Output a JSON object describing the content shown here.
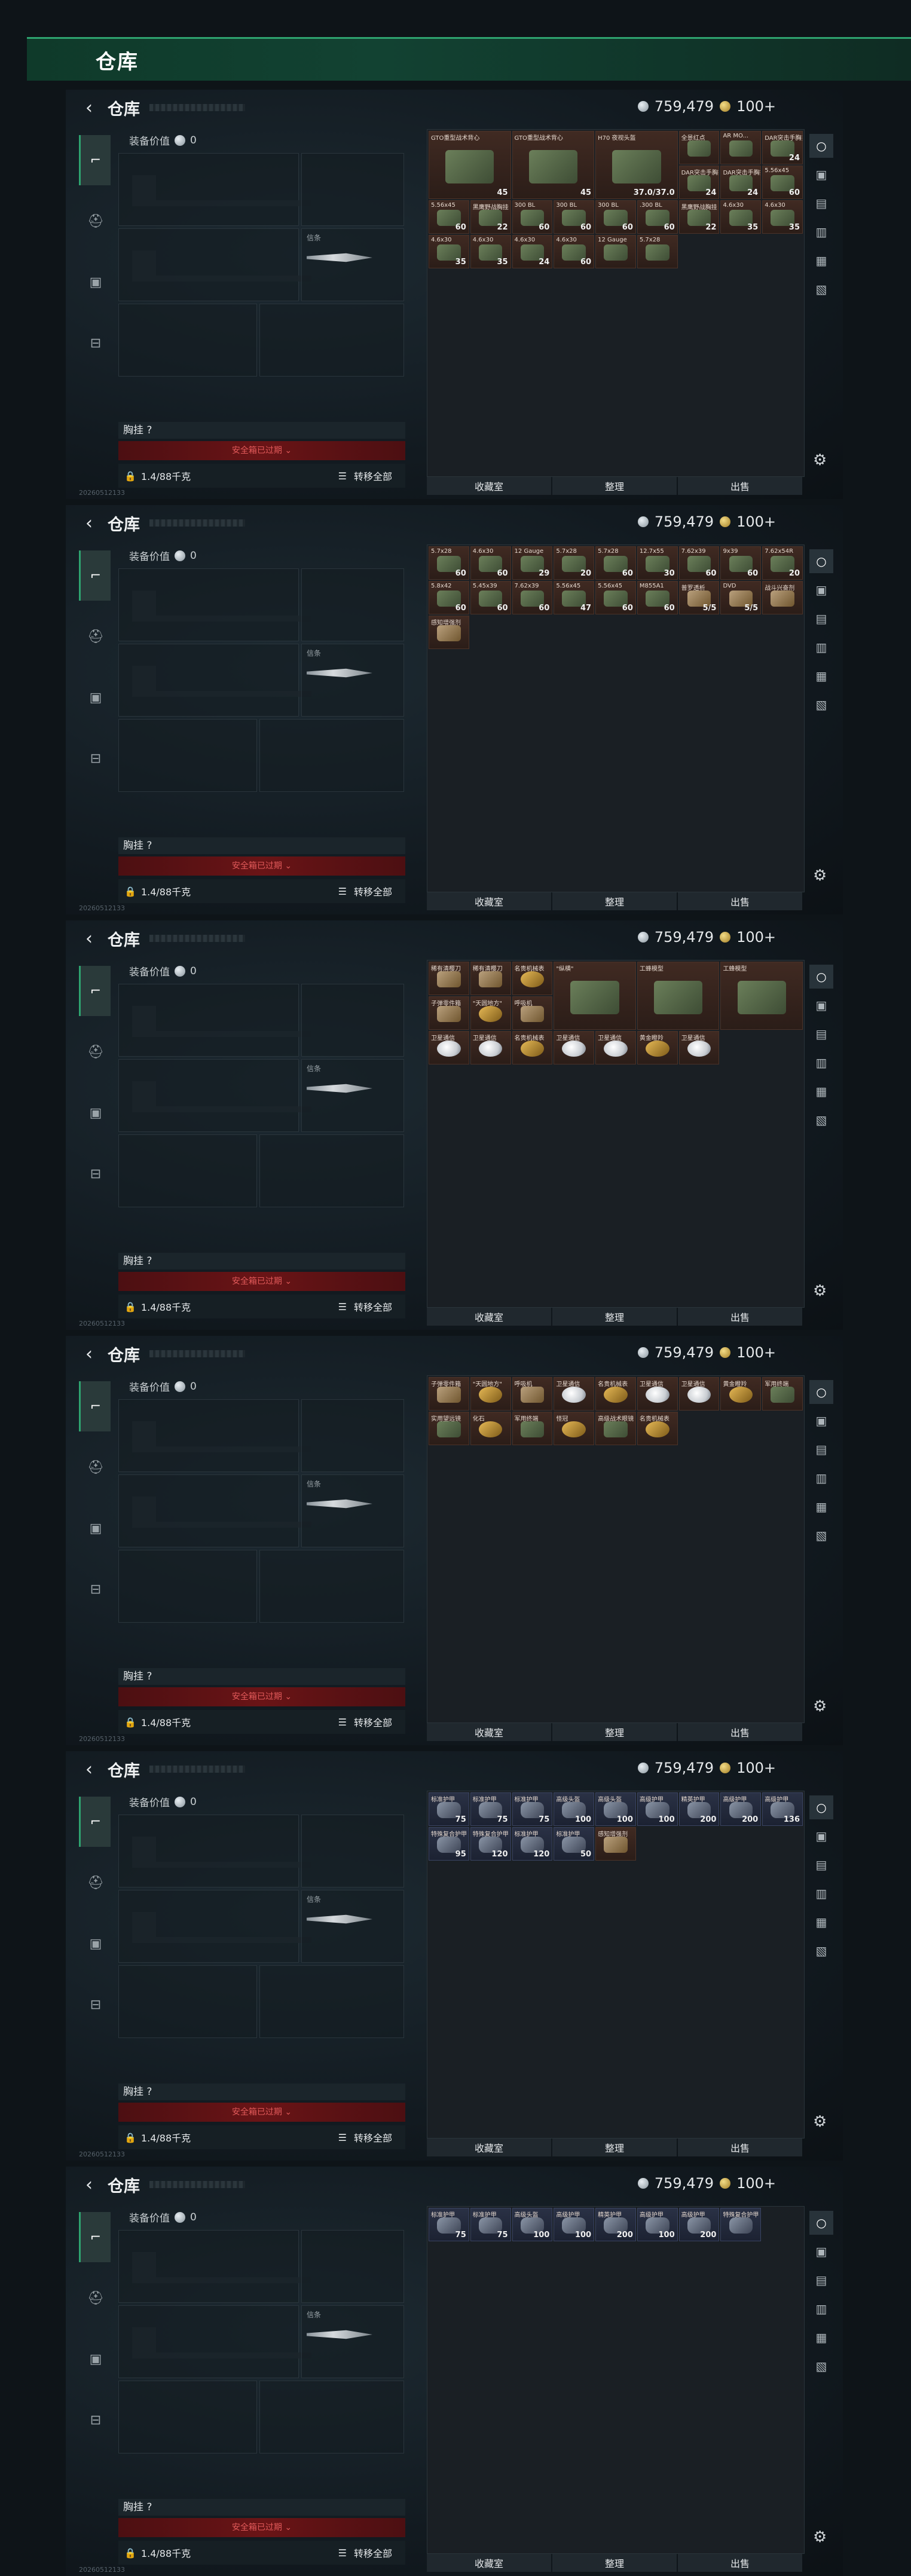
{
  "page": {
    "title": "仓库"
  },
  "currency": {
    "silver": "759,479",
    "gold": "100+"
  },
  "equipment": {
    "value_label": "装备价值",
    "value": "0",
    "knife_label": "信条",
    "chest_label": "胸挂 ?",
    "expired_label": "安全箱已过期 ⌄",
    "capacity": "1.4/88千克",
    "move_all": "转移全部"
  },
  "actions": {
    "collection": "收藏室",
    "sort": "整理",
    "sell": "出售"
  },
  "tabs": [
    "gun-icon",
    "helmet-icon",
    "backpack-icon",
    "toolbox-icon"
  ],
  "shots": [
    {
      "status": "20260512133",
      "cells": [
        {
          "name": "GTO重型战术背心",
          "count": "45",
          "kind": "big2"
        },
        {
          "name": "GTO重型战术背心",
          "count": "45",
          "kind": "big2"
        },
        {
          "name": "H70 夜视头盔",
          "count": "37.0/37.0",
          "kind": "big2"
        },
        {
          "name": "全景红点",
          "count": "",
          "kind": ""
        },
        {
          "name": "AR MO...",
          "count": "",
          "kind": ""
        },
        {
          "name": "DAR突击手胸挂",
          "count": "24",
          "kind": ""
        },
        {
          "name": "DAR突击手胸挂",
          "count": "24",
          "kind": ""
        },
        {
          "name": "DAR突击手胸挂",
          "count": "24",
          "kind": ""
        },
        {
          "name": "5.56x45",
          "count": "60",
          "kind": ""
        },
        {
          "name": "5.56x45",
          "count": "60",
          "kind": ""
        },
        {
          "name": "黑鹰野战胸挂",
          "count": "22",
          "kind": ""
        },
        {
          "name": "300 BL",
          "count": "60",
          "kind": ""
        },
        {
          "name": "300 BL",
          "count": "60",
          "kind": ""
        },
        {
          "name": "300 BL",
          "count": "60",
          "kind": ""
        },
        {
          "name": ".300 BL",
          "count": "60",
          "kind": ""
        },
        {
          "name": "黑鹰野战胸挂",
          "count": "22",
          "kind": ""
        },
        {
          "name": "4.6x30",
          "count": "35",
          "kind": ""
        },
        {
          "name": "4.6x30",
          "count": "35",
          "kind": ""
        },
        {
          "name": "4.6x30",
          "count": "35",
          "kind": ""
        },
        {
          "name": "4.6x30",
          "count": "35",
          "kind": ""
        },
        {
          "name": "4.6x30",
          "count": "24",
          "kind": ""
        },
        {
          "name": "4.6x30",
          "count": "60",
          "kind": ""
        },
        {
          "name": "12 Gauge",
          "count": "",
          "kind": ""
        },
        {
          "name": "5.7x28",
          "count": "",
          "kind": ""
        }
      ]
    },
    {
      "status": "20260512133",
      "cells": [
        {
          "name": "5.7x28",
          "count": "60",
          "kind": ""
        },
        {
          "name": "4.6x30",
          "count": "60",
          "kind": ""
        },
        {
          "name": "12 Gauge",
          "count": "29",
          "kind": ""
        },
        {
          "name": "5.7x28",
          "count": "20",
          "kind": ""
        },
        {
          "name": "5.7x28",
          "count": "60",
          "kind": ""
        },
        {
          "name": "12.7x55",
          "count": "30",
          "kind": ""
        },
        {
          "name": "7.62x39",
          "count": "60",
          "kind": ""
        },
        {
          "name": "9x39",
          "count": "60",
          "kind": ""
        },
        {
          "name": "7.62x54R",
          "count": "20",
          "kind": ""
        },
        {
          "name": "5.8x42",
          "count": "60",
          "kind": ""
        },
        {
          "name": "5.45x39",
          "count": "60",
          "kind": ""
        },
        {
          "name": "7.62x39",
          "count": "60",
          "kind": ""
        },
        {
          "name": "5.56x45",
          "count": "47",
          "kind": ""
        },
        {
          "name": "5.56x45",
          "count": "60",
          "kind": ""
        },
        {
          "name": "M855A1",
          "count": "60",
          "kind": ""
        },
        {
          "name": "普罗透析",
          "count": "5/5",
          "kind": "red"
        },
        {
          "name": "DVD",
          "count": "5/5",
          "kind": "red"
        },
        {
          "name": "战斗兴奋剂",
          "count": "",
          "kind": "red"
        },
        {
          "name": "感知增强剂",
          "count": "",
          "kind": "red"
        }
      ]
    },
    {
      "status": "20260512133",
      "cells": [
        {
          "name": "稀有清樱刀",
          "count": "",
          "kind": "red"
        },
        {
          "name": "稀有清樱刀",
          "count": "",
          "kind": "red"
        },
        {
          "name": "名贵机械表",
          "count": "",
          "kind": "gold"
        },
        {
          "name": "\"纵横\"",
          "count": "",
          "kind": "big2"
        },
        {
          "name": "工蜂模型",
          "count": "",
          "kind": "big2"
        },
        {
          "name": "工蜂模型",
          "count": "",
          "kind": "big2"
        },
        {
          "name": "子弹零件箱",
          "count": "",
          "kind": "red"
        },
        {
          "name": "\"天圆地方\"",
          "count": "",
          "kind": "gold"
        },
        {
          "name": "呼吸机",
          "count": "",
          "kind": "red"
        },
        {
          "name": "卫星通信",
          "count": "",
          "kind": "dish"
        },
        {
          "name": "卫星通信",
          "count": "",
          "kind": "dish"
        },
        {
          "name": "名贵机械表",
          "count": "",
          "kind": "gold"
        },
        {
          "name": "卫星通信",
          "count": "",
          "kind": "dish"
        },
        {
          "name": "卫星通信",
          "count": "",
          "kind": "dish"
        },
        {
          "name": "黄金瞪羚",
          "count": "",
          "kind": "gold"
        },
        {
          "name": "卫星通信",
          "count": "",
          "kind": "dish"
        }
      ]
    },
    {
      "status": "20260512133",
      "cells": [
        {
          "name": "子弹零件箱",
          "count": "",
          "kind": "red"
        },
        {
          "name": "\"天圆地方\"",
          "count": "",
          "kind": "gold"
        },
        {
          "name": "呼吸机",
          "count": "",
          "kind": "red"
        },
        {
          "name": "卫星通信",
          "count": "",
          "kind": "dish"
        },
        {
          "name": "名贵机械表",
          "count": "",
          "kind": "gold"
        },
        {
          "name": "卫星通信",
          "count": "",
          "kind": "dish"
        },
        {
          "name": "卫星通信",
          "count": "",
          "kind": "dish"
        },
        {
          "name": "黄金瞪羚",
          "count": "",
          "kind": "gold"
        },
        {
          "name": "军用终端",
          "count": "",
          "kind": ""
        },
        {
          "name": "实用望远镜",
          "count": "",
          "kind": ""
        },
        {
          "name": "化石",
          "count": "",
          "kind": "gold"
        },
        {
          "name": "军用终端",
          "count": "",
          "kind": ""
        },
        {
          "name": "怪冠",
          "count": "",
          "kind": "gold"
        },
        {
          "name": "高级战术眼镜",
          "count": "",
          "kind": ""
        },
        {
          "name": "名贵机械表",
          "count": "",
          "kind": "gold"
        }
      ]
    },
    {
      "status": "20260512133",
      "cells": [
        {
          "name": "标准护甲",
          "count": "75",
          "kind": "blue"
        },
        {
          "name": "标准护甲",
          "count": "75",
          "kind": "blue"
        },
        {
          "name": "标准护甲",
          "count": "75",
          "kind": "blue"
        },
        {
          "name": "高级头盔",
          "count": "100",
          "kind": "blue"
        },
        {
          "name": "高级头盔",
          "count": "100",
          "kind": "blue"
        },
        {
          "name": "高级护甲",
          "count": "100",
          "kind": "blue"
        },
        {
          "name": "精英护甲",
          "count": "200",
          "kind": "blue"
        },
        {
          "name": "高级护甲",
          "count": "200",
          "kind": "blue"
        },
        {
          "name": "高级护甲",
          "count": "136",
          "kind": "blue"
        },
        {
          "name": "特殊复合护甲",
          "count": "95",
          "kind": "blue"
        },
        {
          "name": "特殊复合护甲",
          "count": "120",
          "kind": "blue"
        },
        {
          "name": "标准护甲",
          "count": "120",
          "kind": "blue"
        },
        {
          "name": "标准护甲",
          "count": "50",
          "kind": "blue"
        },
        {
          "name": "感知增强剂",
          "count": "",
          "kind": "red"
        }
      ]
    },
    {
      "status": "20260512133",
      "cells": [
        {
          "name": "标准护甲",
          "count": "75",
          "kind": "blue"
        },
        {
          "name": "标准护甲",
          "count": "75",
          "kind": "blue"
        },
        {
          "name": "高级头盔",
          "count": "100",
          "kind": "blue"
        },
        {
          "name": "高级护甲",
          "count": "100",
          "kind": "blue"
        },
        {
          "name": "精英护甲",
          "count": "200",
          "kind": "blue"
        },
        {
          "name": "高级护甲",
          "count": "100",
          "kind": "blue"
        },
        {
          "name": "高级护甲",
          "count": "200",
          "kind": "blue"
        },
        {
          "name": "特殊复合护甲",
          "count": "",
          "kind": "blue"
        }
      ]
    }
  ]
}
